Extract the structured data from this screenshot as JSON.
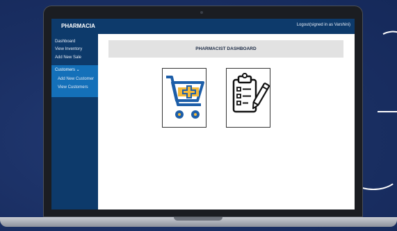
{
  "app": {
    "brand": "PHARMACIA",
    "logout_label": "Logout(signed in as Varshini)"
  },
  "sidebar": {
    "items": [
      {
        "label": "Dashboard"
      },
      {
        "label": "View Inventory"
      },
      {
        "label": "Add New Sale"
      },
      {
        "label": "Customers ⌄"
      },
      {
        "label": "Add New Customer"
      },
      {
        "label": "View Customers"
      }
    ]
  },
  "main": {
    "title": "PHARMACIST DASHBOARD",
    "cards": [
      {
        "icon": "shopping-cart-add-icon"
      },
      {
        "icon": "clipboard-edit-icon"
      }
    ]
  },
  "colors": {
    "nav_bg": "#0d3a6b",
    "nav_active": "#1470b9",
    "cart_blue": "#1d5ea8",
    "cart_yellow": "#f4b93a",
    "page_bg": "#1a2f63"
  }
}
